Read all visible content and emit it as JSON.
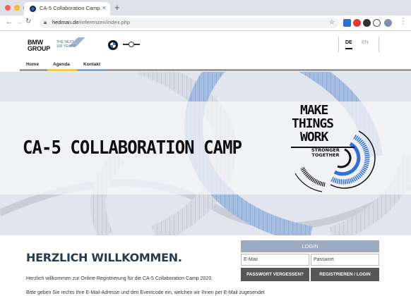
{
  "browser": {
    "tab_title": "CA-5 Collaboration Camp.",
    "tab_close": "×",
    "new_tab": "+",
    "url_host": "hedman.de",
    "url_path": "/referenzen/index.php",
    "traffic_lights": [
      "#ff5f57",
      "#febc2e",
      "#28c840"
    ]
  },
  "header": {
    "logo_line1": "BMW",
    "logo_line2": "GROUP",
    "tagline_line1": "THE NEXT",
    "tagline_line2": "100 YEARS",
    "languages": [
      "DE",
      "EN"
    ],
    "active_language": "DE"
  },
  "nav": {
    "items": [
      {
        "label": "Home",
        "bar_color": "#9b9b9b"
      },
      {
        "label": "Agenda",
        "bar_color": "#f2c94c"
      },
      {
        "label": "Kontakt",
        "bar_color": "#8aa3c8"
      }
    ]
  },
  "hero": {
    "title": "CA-5 COLLABORATION CAMP",
    "logo_lines": [
      "MAKE",
      "THINGS",
      "WORK"
    ],
    "logo_sub": [
      "STRONGER",
      "TOGETHER"
    ],
    "accent": "#2f6fdc"
  },
  "content": {
    "welcome_title": "HERZLICH WILLKOMMEN.",
    "paragraph_1": "Herzlich willkommen zur Online-Registrierung für die CA-5 Collaboration Camp 2020.",
    "paragraph_2": "Bitte geben Sie rechts Ihre E-Mail-Adresse und den Eventcode ein, welchen wir Ihnen per E-Mail zugesendet"
  },
  "login": {
    "heading": "LOGIN",
    "email_placeholder": "E-Mail",
    "password_placeholder": "Passwort",
    "forgot_label": "PASSWORT VERGESSEN?",
    "register_label": "REGISTRIEREN / LOGIN"
  }
}
